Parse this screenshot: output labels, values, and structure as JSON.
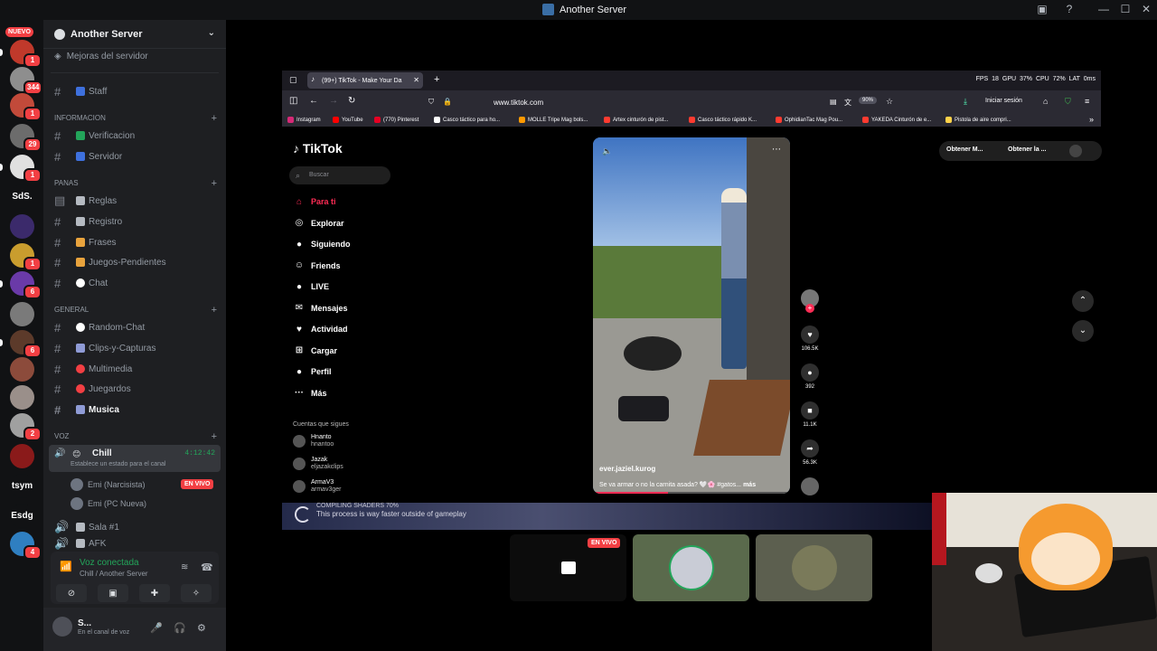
{
  "window": {
    "title": "Another Server",
    "controls": [
      "▣",
      "?",
      "—",
      "☐",
      "✕"
    ]
  },
  "servers": [
    {
      "label": "",
      "color": "#c0392b",
      "badge": "1"
    },
    {
      "label": "",
      "color": "#8e8e8e",
      "badge": "344"
    },
    {
      "label": "",
      "color": "#c24a3a",
      "badge": "1"
    },
    {
      "label": "",
      "color": "#6c6c6c",
      "badge": "29"
    },
    {
      "label": "",
      "color": "#e0e0e0",
      "badge": "1"
    },
    {
      "label": "SdS.",
      "color": "#111214",
      "badge": ""
    },
    {
      "label": "",
      "color": "#3b2a6b",
      "badge": ""
    },
    {
      "label": "",
      "color": "#c99d2e",
      "badge": "1"
    },
    {
      "label": "",
      "color": "#6a3aa8",
      "badge": "6"
    },
    {
      "label": "",
      "color": "#7a7a7a",
      "badge": ""
    },
    {
      "label": "",
      "color": "#5c3a2a",
      "badge": "6"
    },
    {
      "label": "",
      "color": "#8c4b3b",
      "badge": ""
    },
    {
      "label": "",
      "color": "#9a8f8a",
      "badge": ""
    },
    {
      "label": "",
      "color": "#a0a0a0",
      "badge": "2"
    },
    {
      "label": "",
      "color": "#8a1a1a",
      "badge": ""
    },
    {
      "label": "tsym",
      "color": "#111214",
      "badge": ""
    },
    {
      "label": "Esdg",
      "color": "#111214",
      "badge": ""
    },
    {
      "label": "",
      "color": "#2f7fc1",
      "badge": "4"
    }
  ],
  "rail_new_label": "NUEVO",
  "sidebar": {
    "server_name": "Another Server",
    "boosts": "Mejoras del servidor",
    "channels_top": [
      {
        "emoji_color": "#3e70dd",
        "name": "Staff"
      }
    ],
    "categories": [
      {
        "name": "INFORMACION",
        "channels": [
          {
            "emoji_color": "#23a55a",
            "name": "Verificacion"
          },
          {
            "emoji_color": "#3e70dd",
            "name": "Servidor"
          }
        ]
      },
      {
        "name": "PANAS",
        "channels": [
          {
            "emoji_color": "#b5bac1",
            "name": "Reglas"
          },
          {
            "emoji_color": "#b5bac1",
            "name": "Registro"
          },
          {
            "emoji_color": "#e8a33d",
            "name": "Frases"
          },
          {
            "emoji_color": "#e8a33d",
            "name": "Juegos-Pendientes"
          },
          {
            "emoji_color": "#ffffff",
            "name": "Chat"
          }
        ]
      },
      {
        "name": "GENERAL",
        "channels": [
          {
            "emoji_color": "#ffffff",
            "name": "Random-Chat"
          },
          {
            "emoji_color": "#8f9bd6",
            "name": "Clips-y-Capturas"
          },
          {
            "emoji_color": "#f23f43",
            "name": "Multimedia"
          },
          {
            "emoji_color": "#f23f43",
            "name": "Juegardos"
          },
          {
            "emoji_color": "#8f9bd6",
            "name": "Musica"
          }
        ]
      }
    ],
    "voice_category": "VOZ",
    "voice_channel": {
      "name": "Chill",
      "timer": "4:12:42",
      "status": "Establece un estado para el canal",
      "users": [
        {
          "name": "Emi (Narcisista)",
          "live": "EN VIVO"
        },
        {
          "name": "Emi (PC Nueva)",
          "live": ""
        }
      ]
    },
    "other_voice": [
      {
        "name": "Sala #1"
      },
      {
        "name": "AFK"
      }
    ],
    "voice_panel": {
      "status": "Voz conectada",
      "location": "Chill / Another Server"
    },
    "user": {
      "name": "S...",
      "status": "En el canal de voz"
    }
  },
  "browser": {
    "tab_title": "(99+) TikTok - Make Your Da",
    "stats": "FPS 18   GPU 37%   CPU 72%   LAT 0ms",
    "url": "www.tiktok.com",
    "zoom": "90%",
    "login": "Iniciar sesión",
    "bookmarks": [
      {
        "label": "Instagram",
        "color": "#d62976"
      },
      {
        "label": "YouTube",
        "color": "#ff0000"
      },
      {
        "label": "(770) Pinterest",
        "color": "#e60023"
      },
      {
        "label": "Casco táctico para ho...",
        "color": "#ffffff"
      },
      {
        "label": "MOLLE Tripe Mag bols...",
        "color": "#ff9900"
      },
      {
        "label": "Artex cinturón de pist...",
        "color": "#ff3b30"
      },
      {
        "label": "Casco táctico rápido K...",
        "color": "#ff3b30"
      },
      {
        "label": "OphidianTac Mag Pou...",
        "color": "#ff3b30"
      },
      {
        "label": "YAKEDA Cinturón de e...",
        "color": "#ff3b30"
      },
      {
        "label": "Pistola de aire compri...",
        "color": "#ffd24a"
      }
    ]
  },
  "tiktok": {
    "logo": "TikTok",
    "search_placeholder": "Buscar",
    "nav": [
      {
        "label": "Para ti",
        "icon": "⌂"
      },
      {
        "label": "Explorar",
        "icon": "◎"
      },
      {
        "label": "Siguiendo",
        "icon": "●"
      },
      {
        "label": "Friends",
        "icon": "☺"
      },
      {
        "label": "LIVE",
        "icon": "●"
      },
      {
        "label": "Mensajes",
        "icon": "✉"
      },
      {
        "label": "Actividad",
        "icon": "♥"
      },
      {
        "label": "Cargar",
        "icon": "⊞"
      },
      {
        "label": "Perfil",
        "icon": "●"
      },
      {
        "label": "Más",
        "icon": "···"
      }
    ],
    "following_title": "Cuentas que sigues",
    "following": [
      {
        "name": "Hnanto",
        "handle": "hnantoo"
      },
      {
        "name": "Jazak",
        "handle": "eljazakclips"
      },
      {
        "name": "ArmaV3",
        "handle": "armav3ger"
      }
    ],
    "video": {
      "author": "ever.jaziel.kurog",
      "caption": "Se va armar o no la carnita asada? 🤍🌸 #gatos...",
      "more": "más",
      "progress": 0.38
    },
    "actions": [
      {
        "icon": "♥",
        "count": "106.5K"
      },
      {
        "icon": "●",
        "count": "392"
      },
      {
        "icon": "■",
        "count": "11.1K"
      },
      {
        "icon": "➦",
        "count": "56.3K"
      }
    ],
    "get_app": [
      "Obtener M...",
      "Obtener la ..."
    ]
  },
  "stream_strip": {
    "line1": "COMPILING SHADERS 70%",
    "line2": "This process is way faster outside of gameplay"
  },
  "tiles": {
    "live_badge": "EN VIVO"
  }
}
